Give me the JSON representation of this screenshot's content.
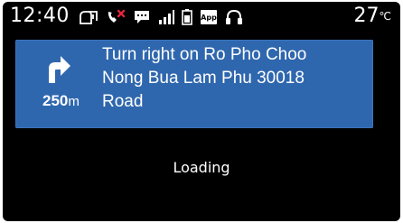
{
  "status_bar": {
    "time": "12:40",
    "temperature": "27",
    "temperature_unit": "℃",
    "app_badge": "App",
    "icons": [
      "notification-icon",
      "phone-missed-icon",
      "message-icon",
      "signal-icon",
      "battery-icon",
      "app-icon",
      "headphones-icon"
    ]
  },
  "navigation": {
    "direction": "turn-right",
    "instruction": "Turn right on Ro Pho Choo\nNong Bua Lam Phu 30018\nRoad",
    "distance_value": "250",
    "distance_unit": "m"
  },
  "main": {
    "status_text": "Loading"
  },
  "colors": {
    "background": "#000000",
    "nav_card": "#2f67ae",
    "text": "#ffffff"
  }
}
